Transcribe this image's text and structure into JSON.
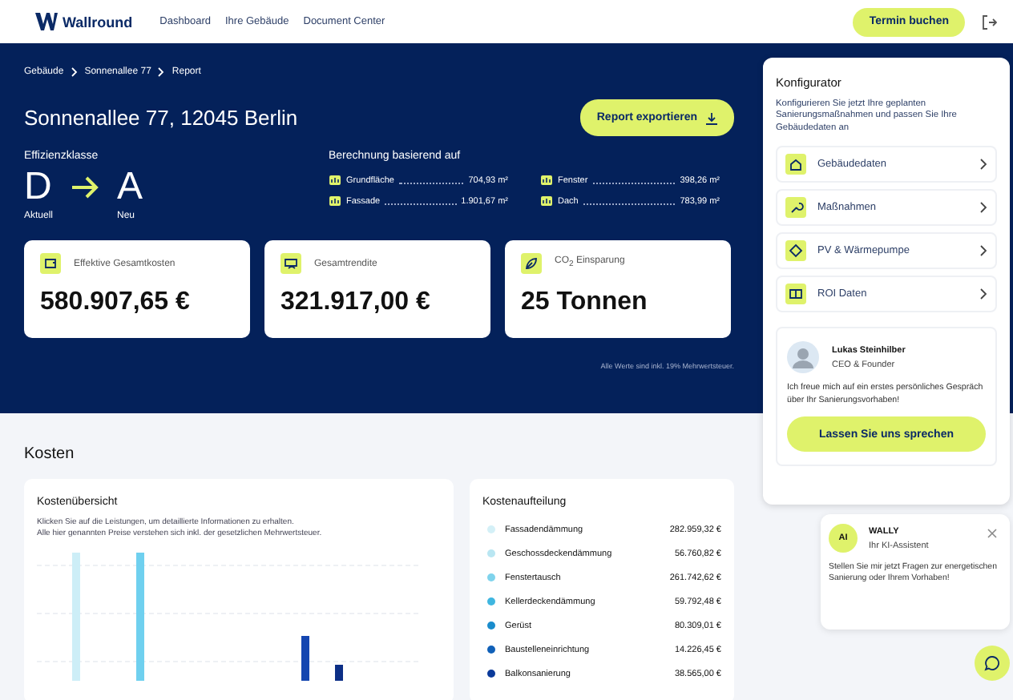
{
  "header": {
    "brand": "Wallround",
    "nav": [
      "Dashboard",
      "Ihre Gebäude",
      "Document Center"
    ],
    "cta": "Termin buchen"
  },
  "hero": {
    "breadcrumb": [
      "Gebäude",
      "Sonnenallee 77",
      "Report"
    ],
    "title": "Sonnenallee 77, 12045 Berlin",
    "export_button": "Report exportieren",
    "efficiency": {
      "label": "Effizienzklasse",
      "current": "D",
      "current_label": "Aktuell",
      "target": "A",
      "target_label": "Neu"
    },
    "basis": {
      "title": "Berechnung basierend auf",
      "items": [
        {
          "label": "Grundfläche",
          "value": "704,93 m²"
        },
        {
          "label": "Fenster",
          "value": "398,26 m²"
        },
        {
          "label": "Fassade",
          "value": "1.901,67 m²"
        },
        {
          "label": "Dach",
          "value": "783,99 m²"
        }
      ]
    },
    "stats": [
      {
        "label": "Effektive Gesamtkosten",
        "value": "580.907,65 €"
      },
      {
        "label": "Gesamtrendite",
        "value": "321.917,00 €"
      },
      {
        "label": "CO$_{2}$ Einsparung",
        "value": "25 Tonnen"
      }
    ],
    "footnote": "Alle Werte sind inkl. 19% Mehrwertsteuer."
  },
  "costs": {
    "title": "Kosten",
    "overview": {
      "title": "Kostenübersicht",
      "text": "Klicken Sie auf die Leistungen, um detaillierte Informationen zu erhalten.\nAlle hier genannten Preise verstehen sich inkl. der gesetzlichen Mehrwertsteuer."
    },
    "breakdown": {
      "title": "Kostenaufteilung",
      "items": [
        {
          "label": "Fassadendämmung",
          "value": "282.959,32 €",
          "color": "#d4f0f7"
        },
        {
          "label": "Geschossdeckendämmung",
          "value": "56.760,82 €",
          "color": "#b9e6f2"
        },
        {
          "label": "Fenstertausch",
          "value": "261.742,62 €",
          "color": "#7fd3ec"
        },
        {
          "label": "Kellerdeckendämmung",
          "value": "59.792,48 €",
          "color": "#3fb6e0"
        },
        {
          "label": "Gerüst",
          "value": "80.309,01 €",
          "color": "#1a8ccc"
        },
        {
          "label": "Baustelleneinrichtung",
          "value": "14.226,45 €",
          "color": "#1060b8"
        },
        {
          "label": "Balkonsanierung",
          "value": "38.565,00 €",
          "color": "#0b3a9a"
        }
      ]
    }
  },
  "configurator": {
    "title": "Konfigurator",
    "text": "Konfigurieren Sie jetzt Ihre geplanten Sanierungsmaßnahmen und passen Sie Ihre Gebäudedaten an",
    "items": [
      "Gebäudedaten",
      "Maßnahmen",
      "PV & Wärmepumpe",
      "ROI Daten"
    ],
    "contact": {
      "name": "Lukas Steinhilber",
      "role": "CEO & Founder",
      "text": "Ich freue mich auf ein erstes persönliches Gespräch über Ihr Sanierungsvorhaben!",
      "button": "Lassen Sie uns sprechen"
    }
  },
  "chat": {
    "avatar": "AI",
    "name": "WALLY",
    "role": "Ihr KI-Assistent",
    "message": "Stellen Sie mir jetzt Fragen zur energetischen Sanierung oder Ihrem Vorhaben!"
  }
}
